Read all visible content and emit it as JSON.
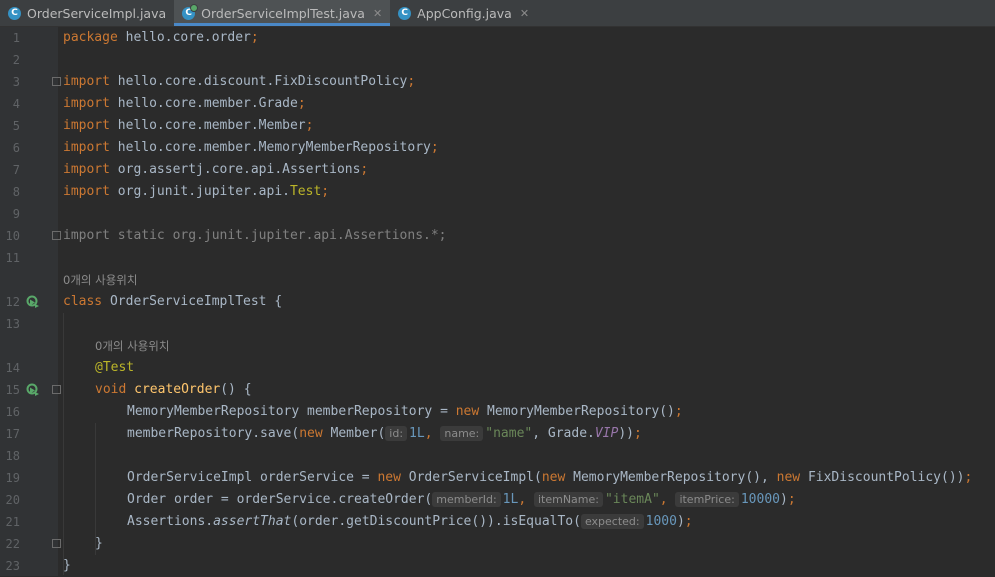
{
  "tabs": [
    {
      "label": "OrderServiceImpl.java",
      "icon": "class-icon",
      "active": false
    },
    {
      "label": "OrderServiceImplTest.java",
      "icon": "test-class-icon",
      "active": true
    },
    {
      "label": "AppConfig.java",
      "icon": "class-icon",
      "active": false
    }
  ],
  "icon_letter": "C",
  "close_glyph": "✕",
  "usage_hint": "0개의 사용위치",
  "line_numbers": [
    "1",
    "2",
    "3",
    "4",
    "5",
    "6",
    "7",
    "8",
    "9",
    "10",
    "11",
    "12",
    "13",
    "14",
    "15",
    "16",
    "17",
    "18",
    "19",
    "20",
    "21",
    "22",
    "23"
  ],
  "code": {
    "l1": {
      "kw": "package",
      "rest": " hello.core.order",
      "semi": ";"
    },
    "l3": {
      "kw": "import",
      "rest": " hello.core.discount.FixDiscountPolicy",
      "semi": ";"
    },
    "l4": {
      "kw": "import",
      "rest": " hello.core.member.Grade",
      "semi": ";"
    },
    "l5": {
      "kw": "import",
      "rest": " hello.core.member.Member",
      "semi": ";"
    },
    "l6": {
      "kw": "import",
      "rest": " hello.core.member.MemoryMemberRepository",
      "semi": ";"
    },
    "l7": {
      "kw": "import",
      "rest": " org.assertj.core.api.Assertions",
      "semi": ";"
    },
    "l8": {
      "kw": "import",
      "rest": " org.junit.jupiter.api.",
      "ann": "Test",
      "semi": ";"
    },
    "l10": {
      "text": "import static org.junit.jupiter.api.Assertions.*;"
    },
    "l12": {
      "kw": "class",
      "rest": " OrderServiceImplTest {"
    },
    "l14": {
      "ann": "@Test"
    },
    "l15": {
      "kw": "void",
      "fn": "createOrder",
      "rest": "() {"
    },
    "l16": {
      "a": "MemoryMemberRepository memberRepository = ",
      "kw": "new",
      "b": " MemoryMemberRepository()",
      "semi": ";"
    },
    "l17": {
      "a": "memberRepository.save(",
      "kw": "new",
      "b": " Member(",
      "h1": "id:",
      "v1": "1L",
      "c1": ", ",
      "h2": "name:",
      "v2": "\"name\"",
      "c2": ", Grade.",
      "const": "VIP",
      "end": "))",
      "semi": ";"
    },
    "l19": {
      "a": "OrderServiceImpl orderService = ",
      "kw1": "new",
      "b": " OrderServiceImpl(",
      "kw2": "new",
      "c": " MemoryMemberRepository(), ",
      "kw3": "new",
      "d": " FixDiscountPolicy())",
      "semi": ";"
    },
    "l20": {
      "a": "Order order = orderService.createOrder(",
      "h1": "memberId:",
      "v1": "1L",
      "c1": ", ",
      "h2": "itemName:",
      "v2": "\"itemA\"",
      "c2": ", ",
      "h3": "itemPrice:",
      "v3": "10000",
      "end": ")",
      "semi": ";"
    },
    "l21": {
      "a": "Assertions.",
      "it": "assertThat",
      "b": "(order.getDiscountPrice()).isEqualTo(",
      "h1": "expected:",
      "v1": "1000",
      "end": ")",
      "semi": ";"
    },
    "l22": {
      "text": "}"
    },
    "l23": {
      "text": "}"
    }
  },
  "colors": {
    "background": "#2b2b2b",
    "gutter": "#313335",
    "keyword": "#cc7832",
    "annotation": "#bbb529",
    "string": "#6a8759",
    "number": "#6897bb",
    "method": "#ffc66d",
    "constant": "#9876aa",
    "tab_accent": "#4a88c7"
  }
}
